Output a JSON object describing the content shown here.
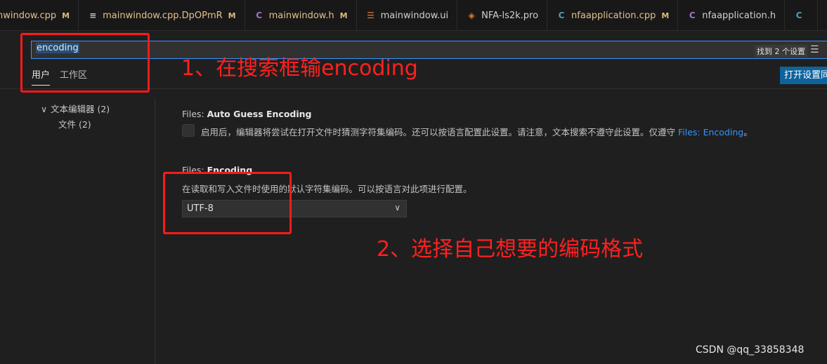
{
  "tabs": [
    {
      "label": "nwindow.cpp",
      "icon_text": "",
      "icon_color": "#6ca6ff",
      "modified": "M",
      "is_modified": true
    },
    {
      "label": "mainwindow.cpp.DpOPmR",
      "icon_text": "≡",
      "icon_color": "#c5c5c5",
      "modified": "M",
      "is_modified": true
    },
    {
      "label": "mainwindow.h",
      "icon_text": "C",
      "icon_color": "#a074c4",
      "modified": "M",
      "is_modified": true
    },
    {
      "label": "mainwindow.ui",
      "icon_text": "☰",
      "icon_color": "#e37933",
      "modified": "",
      "is_modified": false
    },
    {
      "label": "NFA-ls2k.pro",
      "icon_text": "◈",
      "icon_color": "#e37933",
      "modified": "",
      "is_modified": false
    },
    {
      "label": "nfaapplication.cpp",
      "icon_text": "C",
      "icon_color": "#519aba",
      "modified": "M",
      "is_modified": true
    },
    {
      "label": "nfaapplication.h",
      "icon_text": "C",
      "icon_color": "#a074c4",
      "modified": "",
      "is_modified": false
    },
    {
      "label": "",
      "icon_text": "C",
      "icon_color": "#519aba",
      "modified": "",
      "is_modified": false
    }
  ],
  "search": {
    "value": "encoding",
    "match_count": "找到 2 个设置",
    "filter_icon": "filter-list-icon"
  },
  "scope_tabs": {
    "user": "用户",
    "workspace": "工作区"
  },
  "open_settings_json": "打开设置同",
  "toc": {
    "text_editor": "文本编辑器 (2)",
    "files": "文件 (2)"
  },
  "settings": {
    "auto_guess": {
      "category": "Files: ",
      "name": "Auto Guess Encoding",
      "description": "启用后，编辑器将尝试在打开文件时猜测字符集编码。还可以按语言配置此设置。请注意，文本搜索不遵守此设置。仅遵守 ",
      "link": "Files: Encoding",
      "suffix": "。"
    },
    "encoding": {
      "category": "Files: ",
      "name": "Encoding",
      "description": "在读取和写入文件时使用的默认字符集编码。可以按语言对此项进行配置。",
      "value": "UTF-8"
    }
  },
  "annotations": {
    "step1": "1、在搜索框输encoding",
    "step2": "2、选择自己想要的编码格式"
  },
  "watermark": "CSDN @qq_33858348",
  "colors": {
    "accent": "#3794ff",
    "annotation": "#ff1a1a",
    "button": "#0e639c"
  }
}
